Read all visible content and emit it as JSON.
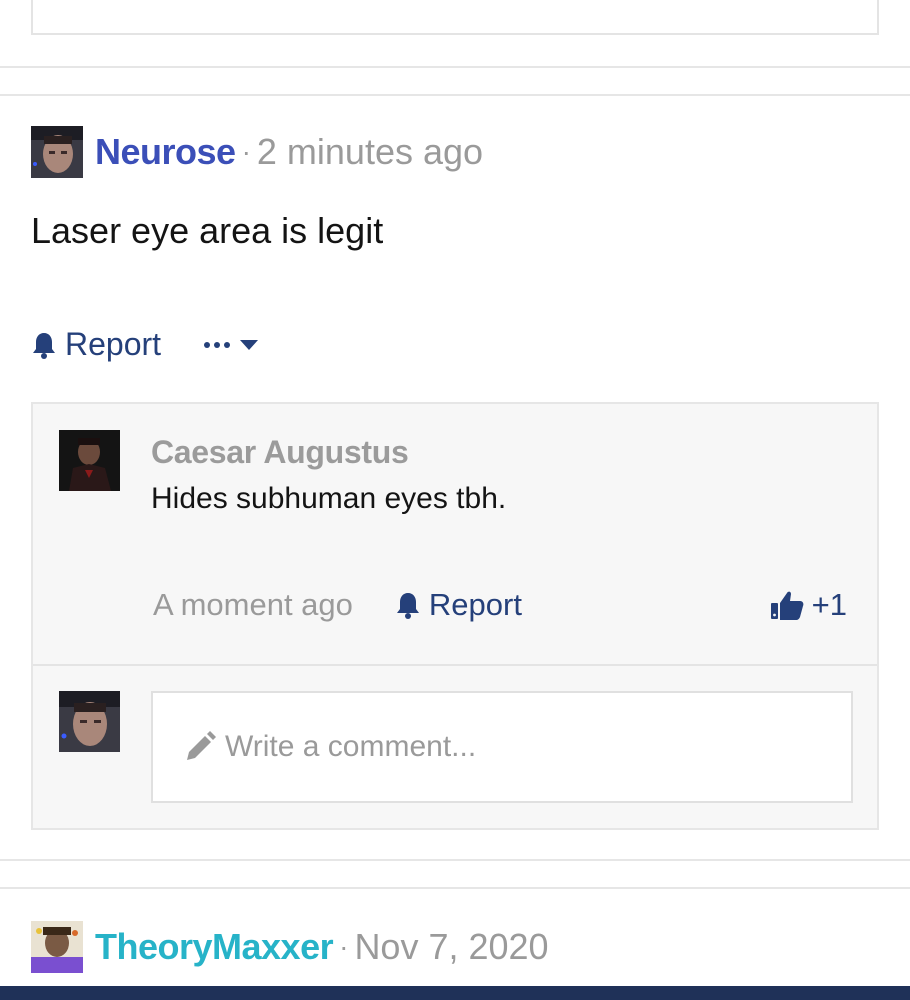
{
  "colors": {
    "author_primary": "#3b4fb8",
    "author_secondary": "#27b3c8",
    "link": "#25407a",
    "muted": "#9a9a9a",
    "bottom_bar": "#1f3158"
  },
  "post": {
    "author": "Neurose",
    "separator": "·",
    "time": "2 minutes ago",
    "body": "Laser eye area is legit",
    "report_label": "Report",
    "report_icon": "bell-icon",
    "more_icon": "ellipsis-icon",
    "more_caret_icon": "caret-down-icon"
  },
  "reply": {
    "author": "Caesar Augustus",
    "text": "Hides subhuman eyes tbh.",
    "time": "A moment ago",
    "report_label": "Report",
    "report_icon": "bell-icon",
    "like_icon": "thumbs-up-icon",
    "like_count": "+1"
  },
  "composer": {
    "placeholder": "Write a comment...",
    "icon": "pencil-icon"
  },
  "next_post": {
    "author": "TheoryMaxxer",
    "separator": "·",
    "time": "Nov 7, 2020"
  }
}
